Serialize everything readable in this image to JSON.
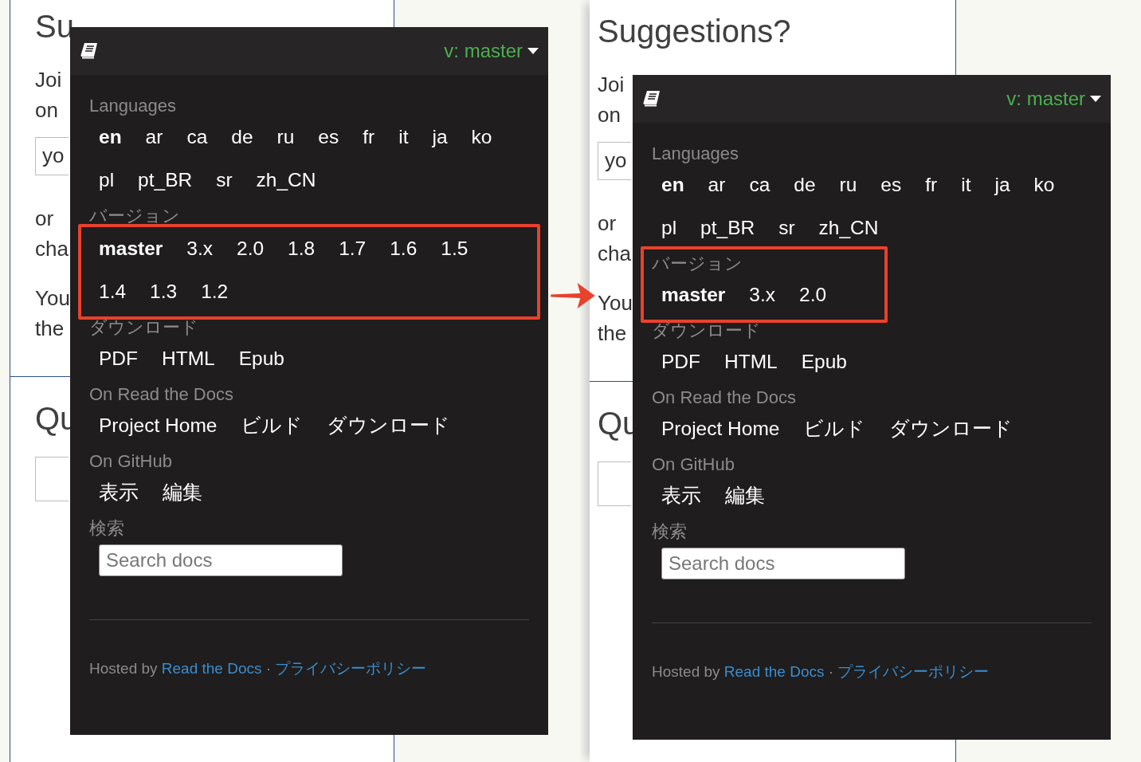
{
  "panes": [
    {
      "page": {
        "blocks": [
          {
            "kind": "title",
            "text": "Su"
          },
          {
            "kind": "paragraph",
            "lines": [
              "Joi",
              "on"
            ]
          },
          {
            "kind": "field",
            "value": "yo"
          },
          {
            "kind": "paragraph",
            "lines": [
              "or",
              "cha"
            ]
          },
          {
            "kind": "paragraph",
            "lines": [
              "You",
              "the"
            ]
          },
          {
            "kind": "divider"
          },
          {
            "kind": "title",
            "text": "Qu"
          },
          {
            "kind": "field"
          }
        ]
      },
      "panel": {
        "version_label": "v: master",
        "sections": [
          {
            "heading": "Languages",
            "items": [
              {
                "label": "en",
                "selected": true
              },
              {
                "label": "ar",
                "selected": false
              },
              {
                "label": "ca",
                "selected": false
              },
              {
                "label": "de",
                "selected": false
              },
              {
                "label": "ru",
                "selected": false
              },
              {
                "label": "es",
                "selected": false
              },
              {
                "label": "fr",
                "selected": false
              },
              {
                "label": "it",
                "selected": false
              },
              {
                "label": "ja",
                "selected": false
              },
              {
                "label": "ko",
                "selected": false
              },
              {
                "label": "pl",
                "selected": false
              },
              {
                "label": "pt_BR",
                "selected": false
              },
              {
                "label": "sr",
                "selected": false
              },
              {
                "label": "zh_CN",
                "selected": false
              }
            ]
          },
          {
            "heading": "バージョン",
            "items_highlighted": true,
            "items": [
              {
                "label": "master",
                "selected": true
              },
              {
                "label": "3.x",
                "selected": false
              },
              {
                "label": "2.0",
                "selected": false
              },
              {
                "label": "1.8",
                "selected": false
              },
              {
                "label": "1.7",
                "selected": false
              },
              {
                "label": "1.6",
                "selected": false
              },
              {
                "label": "1.5",
                "selected": false
              },
              {
                "label": "1.4",
                "selected": false
              },
              {
                "label": "1.3",
                "selected": false
              },
              {
                "label": "1.2",
                "selected": false
              }
            ]
          },
          {
            "heading": "ダウンロード",
            "items": [
              {
                "label": "PDF"
              },
              {
                "label": "HTML"
              },
              {
                "label": "Epub"
              }
            ]
          },
          {
            "heading": "On Read the Docs",
            "items": [
              {
                "label": "Project Home"
              },
              {
                "label": "ビルド"
              },
              {
                "label": "ダウンロード"
              }
            ]
          },
          {
            "heading": "On GitHub",
            "items": [
              {
                "label": "表示"
              },
              {
                "label": "編集"
              }
            ]
          }
        ],
        "search": {
          "heading": "検索",
          "placeholder": "Search docs"
        },
        "footer": {
          "prefix": "Hosted by",
          "links": [
            "Read the Docs",
            "プライバシーポリシー"
          ],
          "separator": "·"
        }
      }
    },
    {
      "page": {
        "blocks": [
          {
            "kind": "title",
            "text": "Suggestions?"
          },
          {
            "kind": "paragraph",
            "lines": [
              "Joi",
              "on"
            ]
          },
          {
            "kind": "field",
            "value": "yo"
          },
          {
            "kind": "paragraph",
            "lines": [
              "or",
              "cha"
            ]
          },
          {
            "kind": "paragraph",
            "lines": [
              "You",
              "the"
            ]
          },
          {
            "kind": "divider"
          },
          {
            "kind": "title",
            "text": "Qu"
          },
          {
            "kind": "field"
          }
        ]
      },
      "panel": {
        "version_label": "v: master",
        "sections": [
          {
            "heading": "Languages",
            "items": [
              {
                "label": "en",
                "selected": true
              },
              {
                "label": "ar",
                "selected": false
              },
              {
                "label": "ca",
                "selected": false
              },
              {
                "label": "de",
                "selected": false
              },
              {
                "label": "ru",
                "selected": false
              },
              {
                "label": "es",
                "selected": false
              },
              {
                "label": "fr",
                "selected": false
              },
              {
                "label": "it",
                "selected": false
              },
              {
                "label": "ja",
                "selected": false
              },
              {
                "label": "ko",
                "selected": false
              },
              {
                "label": "pl",
                "selected": false
              },
              {
                "label": "pt_BR",
                "selected": false
              },
              {
                "label": "sr",
                "selected": false
              },
              {
                "label": "zh_CN",
                "selected": false
              }
            ]
          },
          {
            "heading": "バージョン",
            "highlighted": true,
            "items": [
              {
                "label": "master",
                "selected": true
              },
              {
                "label": "3.x",
                "selected": false
              },
              {
                "label": "2.0",
                "selected": false
              }
            ]
          },
          {
            "heading": "ダウンロード",
            "items": [
              {
                "label": "PDF"
              },
              {
                "label": "HTML"
              },
              {
                "label": "Epub"
              }
            ]
          },
          {
            "heading": "On Read the Docs",
            "items": [
              {
                "label": "Project Home"
              },
              {
                "label": "ビルド"
              },
              {
                "label": "ダウンロード"
              }
            ]
          },
          {
            "heading": "On GitHub",
            "items": [
              {
                "label": "表示"
              },
              {
                "label": "編集"
              }
            ]
          }
        ],
        "search": {
          "heading": "検索",
          "placeholder": "Search docs"
        },
        "footer": {
          "prefix": "Hosted by",
          "links": [
            "Read the Docs",
            "プライバシーポリシー"
          ],
          "separator": "·"
        }
      }
    }
  ]
}
